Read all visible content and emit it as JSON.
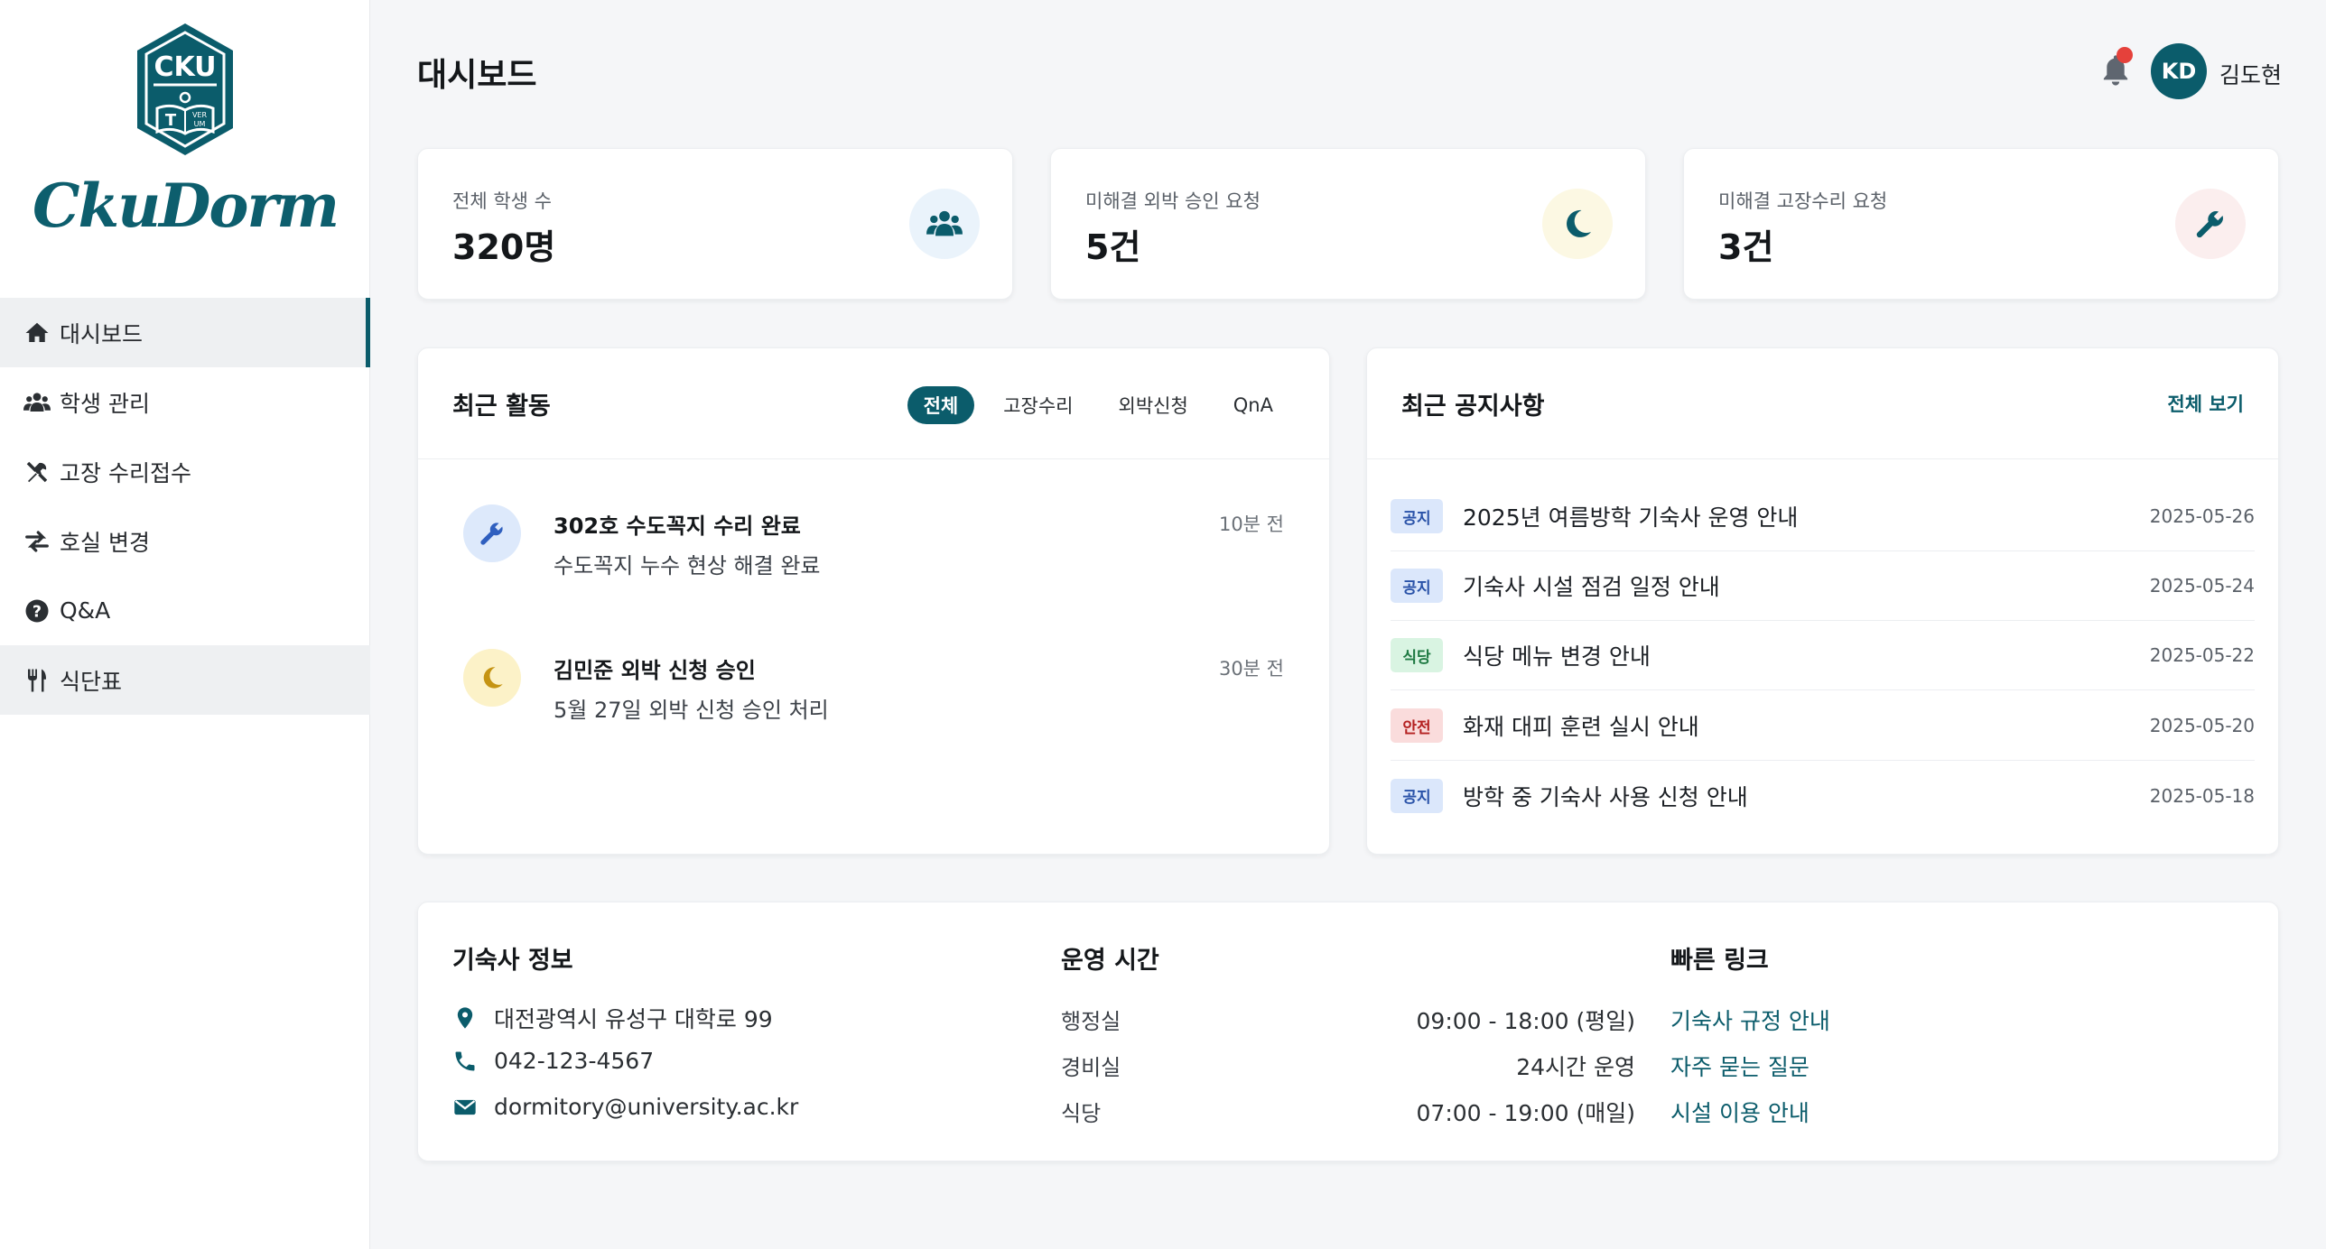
{
  "brand": {
    "shield_text": "CKU",
    "shield_motto": "VERUM",
    "shield_letter": "T",
    "script_name": "CkuDorm",
    "color": "#0b5c6b"
  },
  "sidebar": {
    "items": [
      {
        "label": "대시보드",
        "icon": "home-icon",
        "active": true
      },
      {
        "label": "학생 관리",
        "icon": "users-icon"
      },
      {
        "label": "고장 수리접수",
        "icon": "tools-icon"
      },
      {
        "label": "호실 변경",
        "icon": "swap-icon"
      },
      {
        "label": "Q&A",
        "icon": "question-icon"
      },
      {
        "label": "식단표",
        "icon": "utensils-icon"
      }
    ]
  },
  "header": {
    "title": "대시보드",
    "avatar_initials": "KD",
    "user_name": "김도현",
    "has_notification": true
  },
  "stats": [
    {
      "label": "전체 학생 수",
      "value": "320명",
      "icon": "users-icon",
      "icon_bg": "#eaf3fb",
      "icon_color": "#0b5c6b"
    },
    {
      "label": "미해결 외박 승인 요청",
      "value": "5건",
      "icon": "moon-icon",
      "icon_bg": "#fcf8e3",
      "icon_color": "#0b5c6b"
    },
    {
      "label": "미해결 고장수리 요청",
      "value": "3건",
      "icon": "wrench-icon",
      "icon_bg": "#fbeeee",
      "icon_color": "#0b5c6b"
    }
  ],
  "activity": {
    "title": "최근 활동",
    "tabs": [
      "전체",
      "고장수리",
      "외박신청",
      "QnA"
    ],
    "active_tab": "전체",
    "items": [
      {
        "title": "302호 수도꼭지 수리 완료",
        "desc": "수도꼭지 누수 현상 해결 완료",
        "time": "10분 전",
        "icon": "wrench-icon"
      },
      {
        "title": "김민준 외박 신청 승인",
        "desc": "5월 27일 외박 신청 승인 처리",
        "time": "30분 전",
        "icon": "moon-icon"
      }
    ]
  },
  "notices": {
    "title": "최근 공지사항",
    "see_all": "전체 보기",
    "items": [
      {
        "badge": "공지",
        "type": "notice",
        "title": "2025년 여름방학 기숙사 운영 안내",
        "date": "2025-05-26"
      },
      {
        "badge": "공지",
        "type": "notice",
        "title": "기숙사 시설 점검 일정 안내",
        "date": "2025-05-24"
      },
      {
        "badge": "식당",
        "type": "food",
        "title": "식당 메뉴 변경 안내",
        "date": "2025-05-22"
      },
      {
        "badge": "안전",
        "type": "safe",
        "title": "화재 대피 훈련 실시 안내",
        "date": "2025-05-20"
      },
      {
        "badge": "공지",
        "type": "notice",
        "title": "방학 중 기숙사 사용 신청 안내",
        "date": "2025-05-18"
      }
    ]
  },
  "dorm_info": {
    "title": "기숙사 정보",
    "address": "대전광역시 유성구 대학로 99",
    "phone": "042-123-4567",
    "email": "dormitory@university.ac.kr"
  },
  "hours": {
    "title": "운영 시간",
    "rows": [
      {
        "label": "행정실",
        "value": "09:00 - 18:00 (평일)"
      },
      {
        "label": "경비실",
        "value": "24시간 운영"
      },
      {
        "label": "식당",
        "value": "07:00 - 19:00 (매일)"
      }
    ]
  },
  "quick_links": {
    "title": "빠른 링크",
    "links": [
      "기숙사 규정 안내",
      "자주 묻는 질문",
      "시설 이용 안내"
    ]
  }
}
